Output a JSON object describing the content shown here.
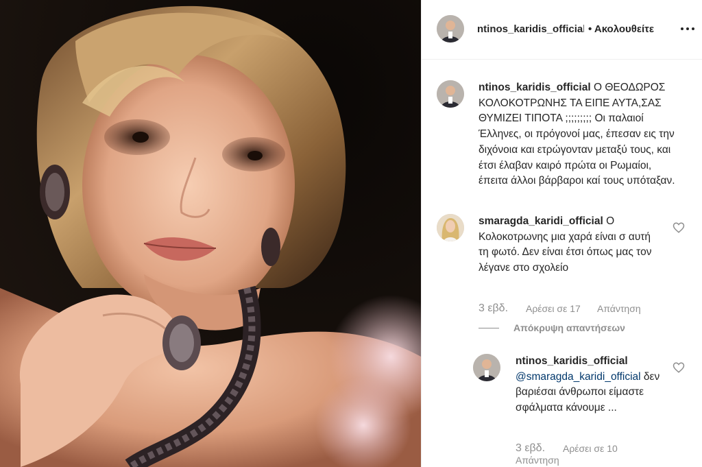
{
  "post": {
    "username": "ntinos_karidis_official",
    "follow_status": "• Ακολουθείτε",
    "more_icon": "more-options-icon"
  },
  "caption": {
    "username": "ntinos_karidis_official",
    "text": "Ο ΘΕΟΔΩΡΟΣ ΚΟΛΟΚΟΤΡΩΝΗΣ ΤΑ ΕΙΠΕ ΑΥΤΑ,ΣΑΣ ΘΥΜΙΖΕΙ ΤΙΠΟΤΑ ;;;;;;;;; Οι παλαιοί Έλληνες, οι πρόγονοί μας, έπεσαν εις την διχόνοια και ετρώγονταν μεταξύ τους, και έτσι έλαβαν καιρό πρώτα οι Ρωμαίοι, έπειτα άλλοι βάρβαροι καί τους υπόταξαν."
  },
  "comments": [
    {
      "username": "smaragda_karidi_official",
      "text": "Ο Κολοκοτρωνης μια χαρά είναι σ αυτή τη φωτό. Δεν είναι έτσι όπως μας τον λέγανε στο σχολείο",
      "time": "3 εβδ.",
      "likes": "Αρέσει σε 17",
      "reply_label": "Απάντηση",
      "hide_replies": "Απόκρυψη απαντήσεων",
      "replies": [
        {
          "username": "ntinos_karidis_official",
          "mention": "@smaragda_karidi_official",
          "text": "δεν βαριέσαι άνθρωποι είμαστε σφάλματα κάνουμε ...",
          "time": "3 εβδ.",
          "likes": "Αρέσει σε 10",
          "reply_label": "Απάντηση"
        }
      ]
    }
  ]
}
